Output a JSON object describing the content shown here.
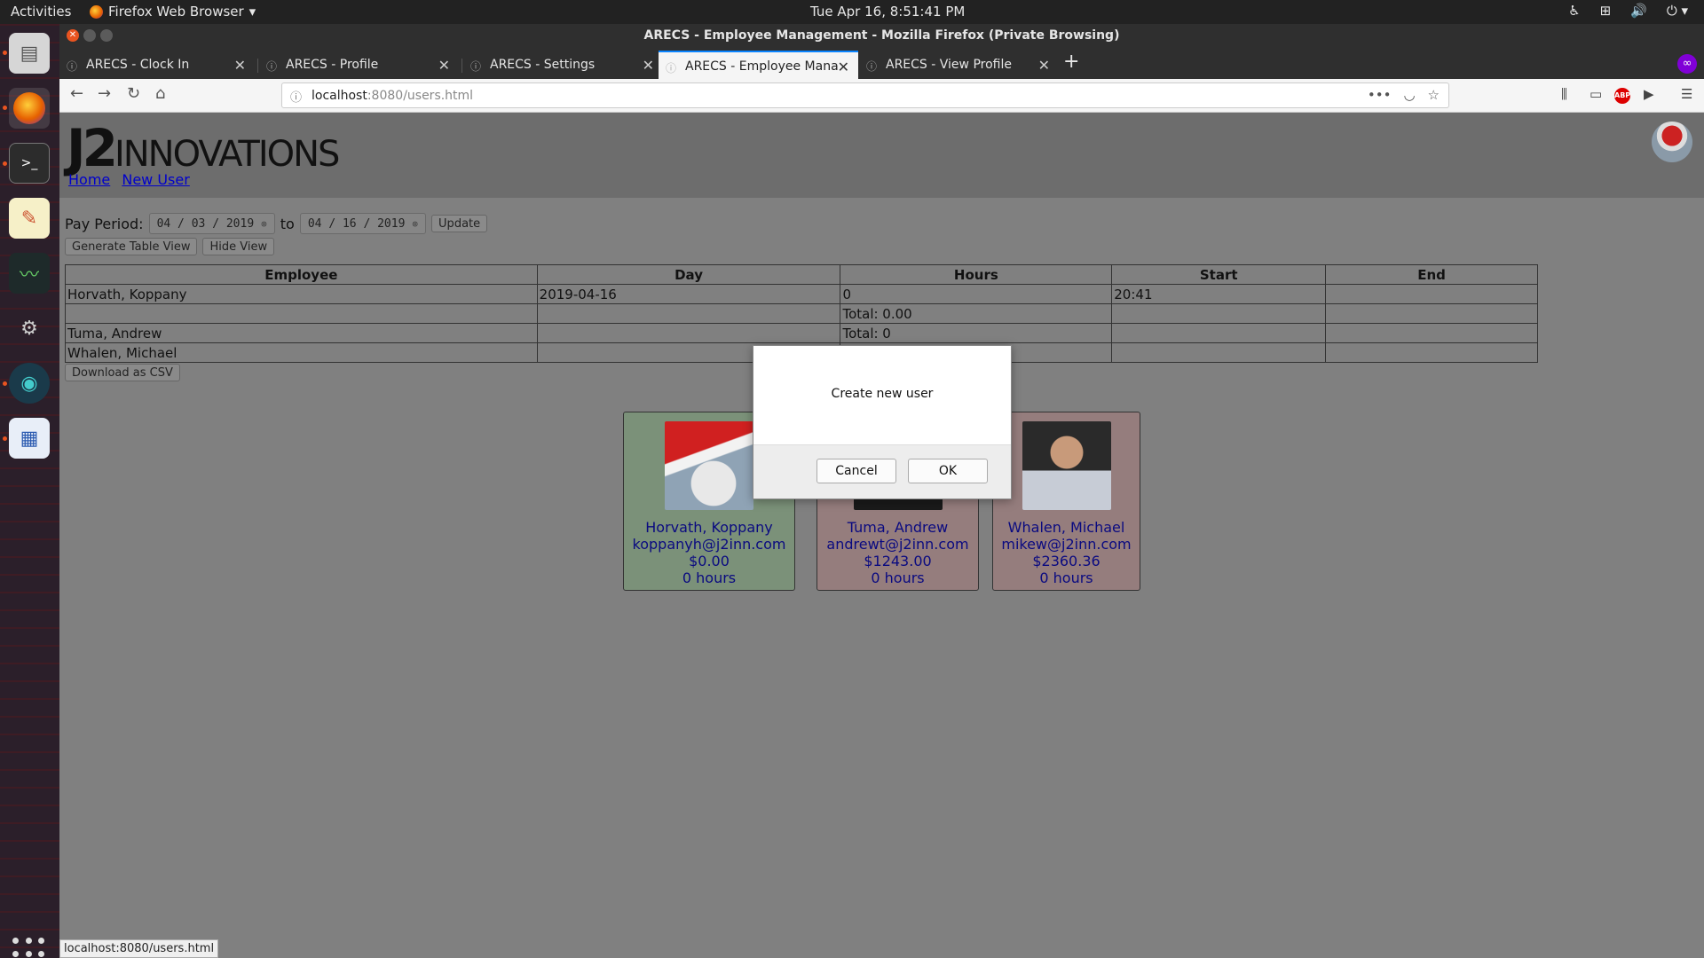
{
  "system": {
    "activities": "Activities",
    "app_menu": "Firefox Web Browser",
    "clock": "Tue Apr 16,  8:51:41 PM"
  },
  "window": {
    "title": "ARECS - Employee Management - Mozilla Firefox (Private Browsing)"
  },
  "tabs": [
    {
      "label": "ARECS - Clock In"
    },
    {
      "label": "ARECS - Profile"
    },
    {
      "label": "ARECS - Settings"
    },
    {
      "label": "ARECS - Employee Maná"
    },
    {
      "label": "ARECS - View Profile"
    }
  ],
  "url": {
    "host": "localhost",
    "path": ":8080/users.html"
  },
  "site": {
    "logo_main": "J2",
    "logo_rest": "INNOVATIONS",
    "nav": [
      "Home",
      "New User"
    ]
  },
  "pay_period": {
    "label": "Pay Period:",
    "from": "04 / 03 / 2019",
    "to_word": "to",
    "to": "04 / 16 / 2019",
    "update_label": "Update"
  },
  "view_buttons": {
    "generate": "Generate Table View",
    "hide": "Hide View"
  },
  "table": {
    "headers": [
      "Employee",
      "Day",
      "Hours",
      "Start",
      "End"
    ],
    "rows": [
      [
        "Horvath, Koppany",
        "2019-04-16",
        "0",
        "20:41",
        ""
      ],
      [
        "",
        "",
        "Total: 0.00",
        "",
        ""
      ],
      [
        "Tuma, Andrew",
        "",
        "Total: 0",
        "",
        ""
      ],
      [
        "Whalen, Michael",
        "",
        "",
        "",
        ""
      ]
    ]
  },
  "csv_label": "Download as CSV",
  "cards": [
    {
      "name": "Horvath, Koppany",
      "email": "koppanyh@j2inn.com",
      "pay": "$0.00",
      "hours": "0 hours",
      "bg": "#7b9179"
    },
    {
      "name": "Tuma, Andrew",
      "email": "andrewt@j2inn.com",
      "pay": "$1243.00",
      "hours": "0 hours",
      "bg": "#957d7d"
    },
    {
      "name": "Whalen, Michael",
      "email": "mikew@j2inn.com",
      "pay": "$2360.36",
      "hours": "0 hours",
      "bg": "#957d7d"
    }
  ],
  "dialog": {
    "message": "Create new user",
    "cancel": "Cancel",
    "ok": "OK"
  },
  "status_url": "localhost:8080/users.html"
}
